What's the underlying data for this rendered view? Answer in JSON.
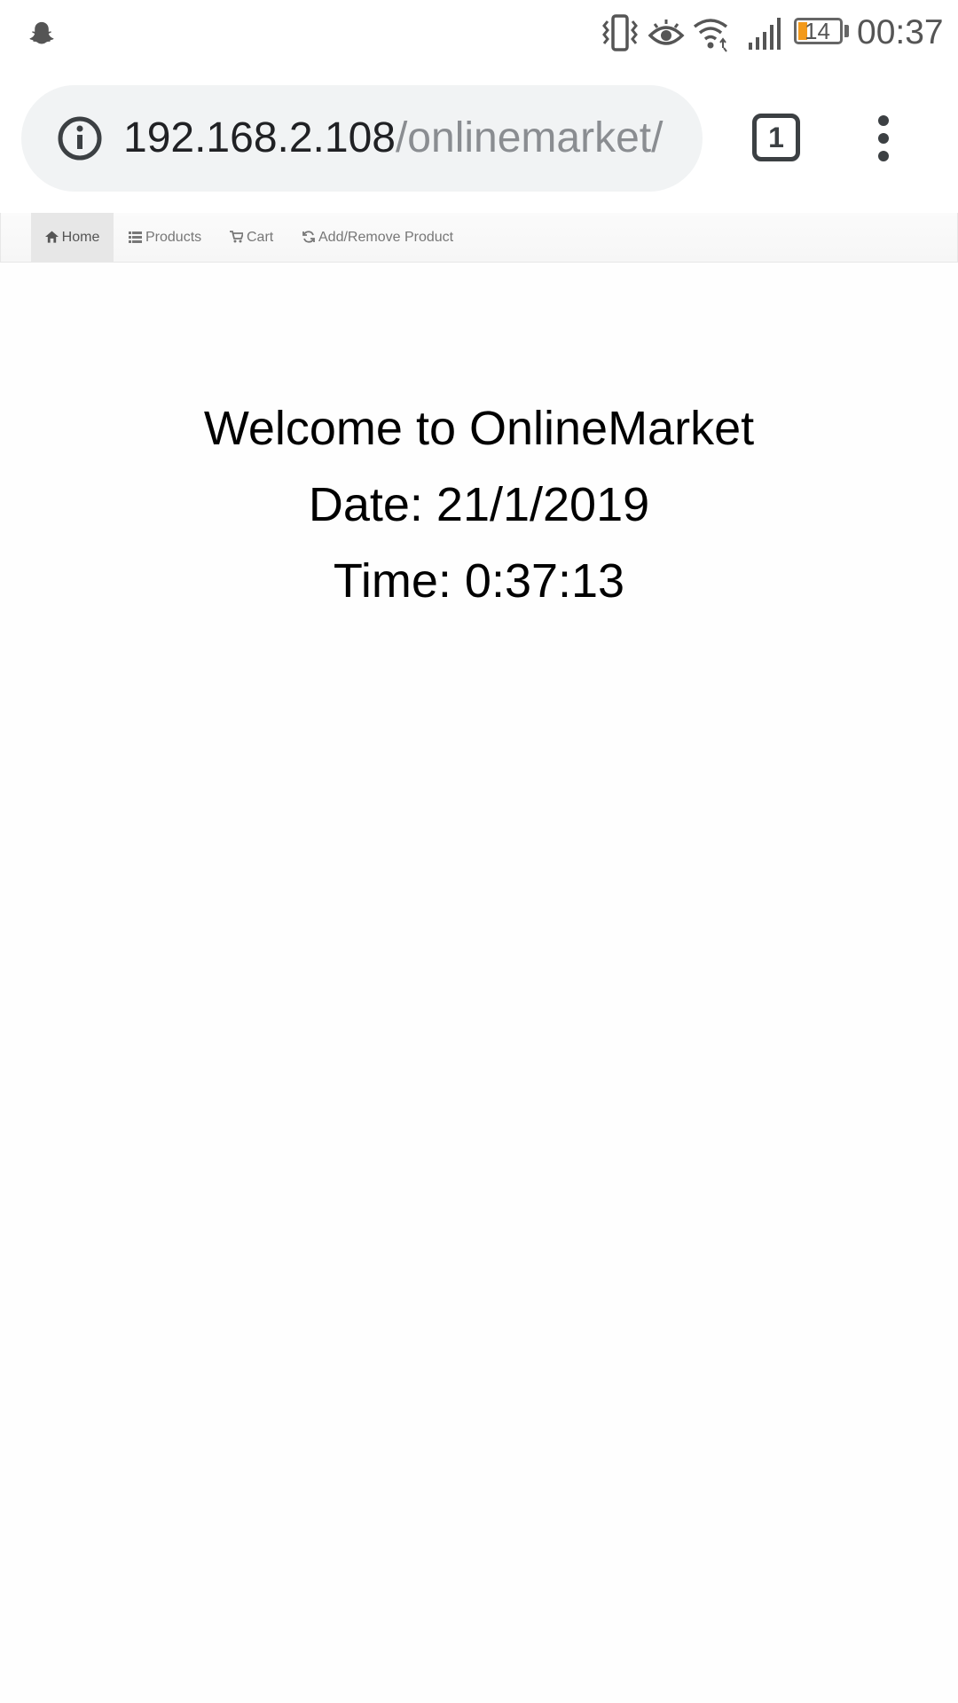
{
  "status_bar": {
    "time": "00:37",
    "battery_level": "14",
    "icons": [
      "snapchat-ghost-icon",
      "vibrate-icon",
      "eye-comfort-icon",
      "wifi-icon",
      "signal-icon",
      "battery-icon"
    ]
  },
  "browser": {
    "url_host": "192.168.2.108",
    "url_path": "/onlinemarket/",
    "tab_count": "1",
    "colors": {
      "omnibox_bg": "#f1f3f4",
      "url_host": "#202124",
      "url_path": "#8a8d91"
    }
  },
  "navbar": {
    "items": [
      {
        "label": "Home",
        "icon": "home-icon",
        "active": true
      },
      {
        "label": "Products",
        "icon": "list-icon",
        "active": false
      },
      {
        "label": "Cart",
        "icon": "cart-icon",
        "active": false
      },
      {
        "label": "Add/Remove Product",
        "icon": "refresh-icon",
        "active": false
      }
    ]
  },
  "main": {
    "welcome": "Welcome to OnlineMarket",
    "date": "Date: 21/1/2019",
    "time": "Time: 0:37:13"
  }
}
